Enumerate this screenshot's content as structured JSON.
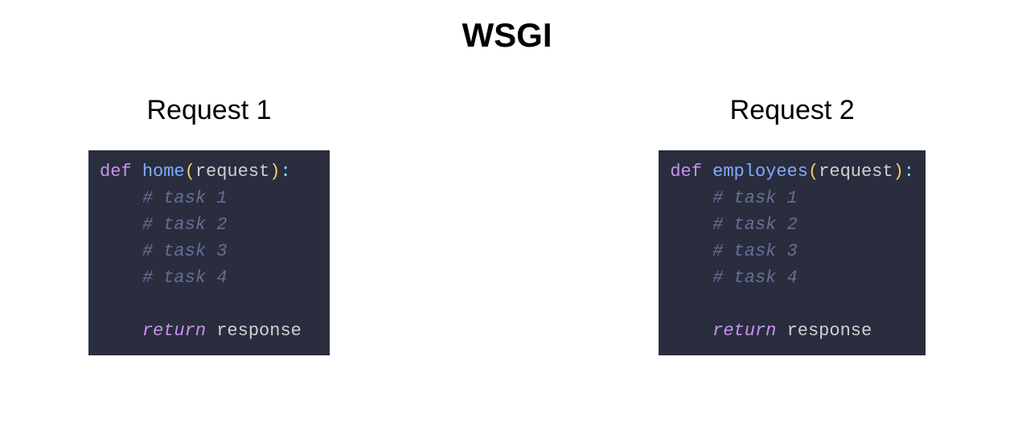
{
  "title": "WSGI",
  "columns": [
    {
      "heading": "Request 1",
      "code": {
        "defKeyword": "def",
        "functionName": "home",
        "parenOpen": "(",
        "param": "request",
        "parenClose": ")",
        "colon": ":",
        "comment1": "# task 1",
        "comment2": "# task 2",
        "comment3": "# task 3",
        "comment4": "# task 4",
        "returnKeyword": "return",
        "returnValue": "response"
      }
    },
    {
      "heading": "Request 2",
      "code": {
        "defKeyword": "def",
        "functionName": "employees",
        "parenOpen": "(",
        "param": "request",
        "parenClose": ")",
        "colon": ":",
        "comment1": "# task 1",
        "comment2": "# task 2",
        "comment3": "# task 3",
        "comment4": "# task 4",
        "returnKeyword": "return",
        "returnValue": "response"
      }
    }
  ]
}
